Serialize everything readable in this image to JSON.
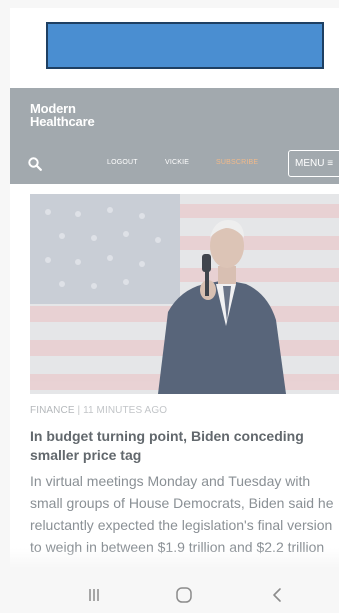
{
  "ad": {
    "color": "#4a8ed1"
  },
  "header": {
    "logo_line1": "Modern",
    "logo_line2": "Healthcare",
    "logout_label": "LOGOUT",
    "user_label": "VICKIE",
    "subscribe_label": "SUBSCRIBE",
    "menu_label": "MENU ≡",
    "background": "#a2a9ae",
    "accent": "#f0b98a"
  },
  "article": {
    "category": "FINANCE",
    "separator": " | ",
    "time": "11 MINUTES AGO",
    "headline": "In budget turning point, Biden conceding smaller price tag",
    "summary": "In virtual meetings Monday and Tuesday with small groups of House Democrats, Biden said he reluctantly expected the legislation's final version to weigh in between $1.9 trillion and $2.2 trillion"
  },
  "icons": {
    "search": "search-icon",
    "recent_apps": "recent-apps-icon",
    "home": "home-icon",
    "back": "back-icon"
  }
}
